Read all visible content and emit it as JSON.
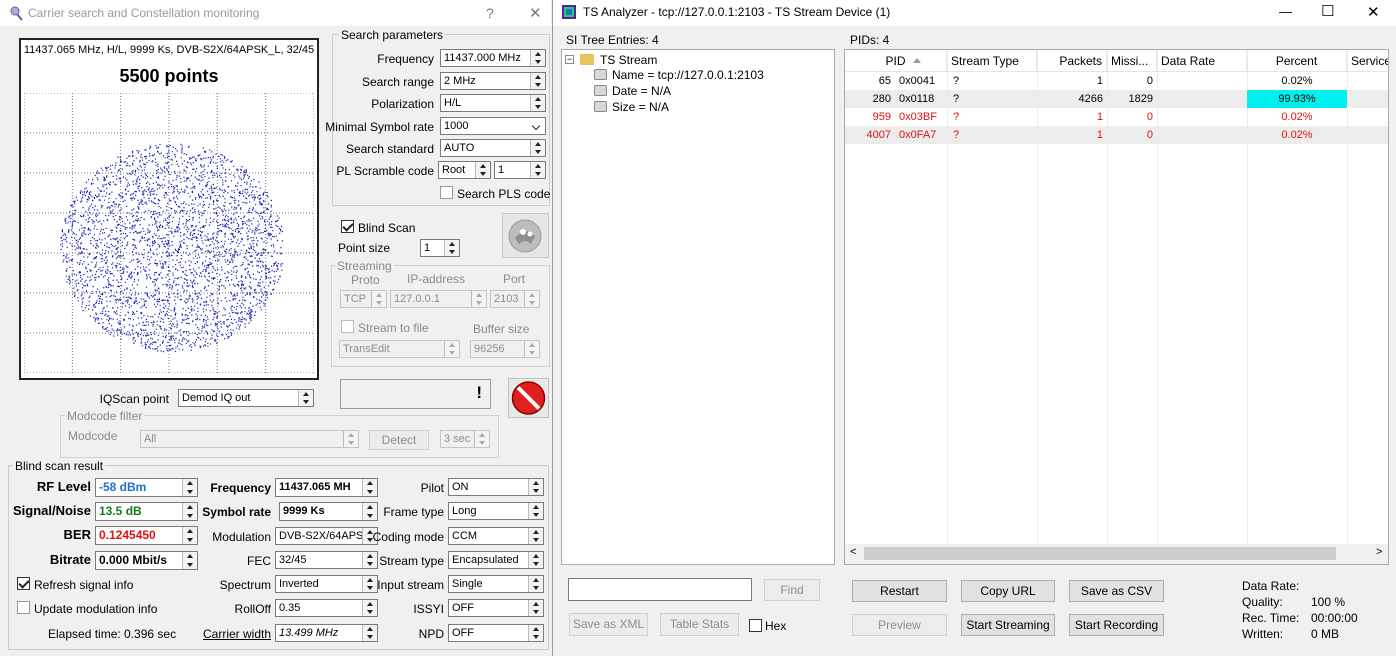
{
  "left_window": {
    "title": "Carrier search and Constellation monitoring",
    "help_glyph": "?",
    "close_glyph": "✕",
    "constellation": {
      "info": "11437.065 MHz, H/L, 9999 Ks, DVB-S2X/64APSK_L, 32/45",
      "points_label": "5500 points",
      "dot_color": "#1a1ab4"
    },
    "search_parameters": {
      "title": "Search parameters",
      "frequency_label": "Frequency",
      "frequency_value": "11437.000 MHz",
      "search_range_label": "Search range",
      "search_range_value": "2 MHz",
      "polarization_label": "Polarization",
      "polarization_value": "H/L",
      "min_symbol_rate_label": "Minimal Symbol rate",
      "min_symbol_rate_value": "1000",
      "search_standard_label": "Search standard",
      "search_standard_value": "AUTO",
      "pl_scramble_label": "PL Scramble code",
      "pl_scramble_mode": "Root",
      "pl_scramble_value": "1",
      "search_pls_label": "Search PLS code",
      "search_pls_checked": false
    },
    "blind_scan_label": "Blind Scan",
    "blind_scan_checked": true,
    "point_size_label": "Point size",
    "point_size_value": "1",
    "streaming": {
      "title": "Streaming",
      "proto_label": "Proto",
      "ip_label": "IP-address",
      "port_label": "Port",
      "proto_value": "TCP",
      "ip_value": "127.0.0.1",
      "port_value": "2103",
      "stream_to_file_label": "Stream to file",
      "buffer_size_label": "Buffer size",
      "app_value": "TransEdit",
      "buffer_size_value": "96256"
    },
    "status_display": "!",
    "iqscan_label": "IQScan point",
    "iqscan_value": "Demod IQ out",
    "modcode_filter": {
      "title": "Modcode filter",
      "modcode_label": "Modcode",
      "modcode_value": "All",
      "detect_label": "Detect",
      "time_value": "3 sec"
    },
    "blind_scan_result": {
      "title": "Blind scan result",
      "rf_level_label": "RF Level",
      "rf_level_value": "-58 dBm",
      "snr_label": "Signal/Noise",
      "snr_value": "13.5 dB",
      "ber_label": "BER",
      "ber_value": "0.1245450",
      "bitrate_label": "Bitrate",
      "bitrate_value": "0.000 Mbit/s",
      "frequency_label": "Frequency",
      "frequency_value": "11437.065 MH",
      "symbol_rate_label": "Symbol rate",
      "symbol_rate_value": "9999 Ks",
      "modulation_label": "Modulation",
      "modulation_value": "DVB-S2X/64APS",
      "fec_label": "FEC",
      "fec_value": "32/45",
      "spectrum_label": "Spectrum",
      "spectrum_value": "Inverted",
      "rolloff_label": "RollOff",
      "rolloff_value": "0.35",
      "carrier_width_label": "Carrier width",
      "carrier_width_value": "13.499 MHz",
      "pilot_label": "Pilot",
      "pilot_value": "ON",
      "frame_type_label": "Frame type",
      "frame_type_value": "Long",
      "coding_mode_label": "Coding mode",
      "coding_mode_value": "CCM",
      "stream_type_label": "Stream type",
      "stream_type_value": "Encapsulated",
      "input_stream_label": "Input stream",
      "input_stream_value": "Single",
      "issyi_label": "ISSYI",
      "issyi_value": "OFF",
      "npd_label": "NPD",
      "npd_value": "OFF"
    },
    "refresh_signal_label": "Refresh signal info",
    "refresh_signal_checked": true,
    "update_modulation_label": "Update modulation info",
    "update_modulation_checked": false,
    "elapsed_time": "Elapsed time: 0.396 sec",
    "colors": {
      "rf_level": "#1f6fd0",
      "snr": "#1a7a1a",
      "ber": "#e01010"
    }
  },
  "right_window": {
    "title": "TS Analyzer - tcp://127.0.0.1:2103 - TS Stream Device (1)",
    "minimize_glyph": "—",
    "maximize_glyph": "☐",
    "close_glyph": "✕",
    "si_tree": {
      "header": "SI Tree Entries: 4",
      "root": "TS Stream",
      "children": [
        "Name = tcp://127.0.0.1:2103",
        "Date = N/A",
        "Size = N/A"
      ],
      "expander": "−"
    },
    "pids_header": "PIDs: 4",
    "pid_table": {
      "columns": [
        "PID",
        "Stream Type",
        "Packets",
        "Missi...",
        "Data Rate",
        "Percent",
        "Service"
      ],
      "rows": [
        {
          "pid": "65",
          "hex": "0x0041",
          "type": "?",
          "packets": "1",
          "missing": "0",
          "rate": "",
          "percent": "0.02%",
          "fill": 0.0002,
          "red": false
        },
        {
          "pid": "280",
          "hex": "0x0118",
          "type": "?",
          "packets": "4266",
          "missing": "1829",
          "rate": "",
          "percent": "99.93%",
          "fill": 0.9993,
          "red": false
        },
        {
          "pid": "959",
          "hex": "0x03BF",
          "type": "?",
          "packets": "1",
          "missing": "0",
          "rate": "",
          "percent": "0.02%",
          "fill": 0.0002,
          "red": true
        },
        {
          "pid": "4007",
          "hex": "0x0FA7",
          "type": "?",
          "packets": "1",
          "missing": "0",
          "rate": "",
          "percent": "0.02%",
          "fill": 0.0002,
          "red": true
        }
      ],
      "bar_color": "#00f0f0",
      "red_color": "#e01010"
    },
    "search_input_value": "",
    "find_label": "Find",
    "save_xml_label": "Save as XML",
    "table_stats_label": "Table Stats",
    "hex_label": "Hex",
    "hex_checked": false,
    "restart_label": "Restart",
    "copy_url_label": "Copy URL",
    "save_csv_label": "Save as CSV",
    "preview_label": "Preview",
    "start_streaming_label": "Start Streaming",
    "start_recording_label": "Start Recording",
    "stats": {
      "data_rate_label": "Data Rate:",
      "data_rate_value": "",
      "quality_label": "Quality:",
      "quality_value": "100 %",
      "rec_time_label": "Rec. Time:",
      "rec_time_value": "00:00:00",
      "written_label": "Written:",
      "written_value": "0 MB"
    }
  }
}
